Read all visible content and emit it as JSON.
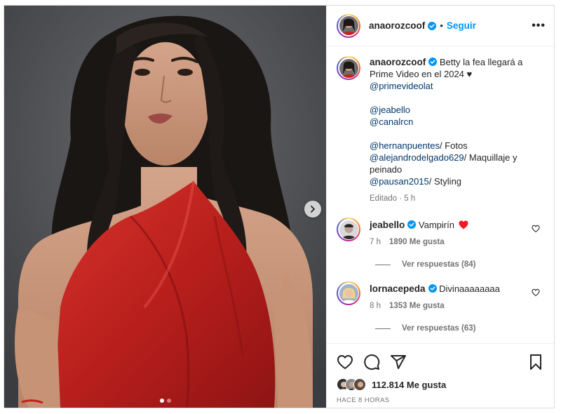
{
  "post": {
    "username": "anaorozcoof",
    "follow_label": "Seguir",
    "separator": "•",
    "more_label": "•••"
  },
  "caption": {
    "username": "anaorozcoof",
    "text": "Betty la fea llegará a Prime Video en el 2024 ♥",
    "mention_1": "@primevideolat",
    "mention_2": "@jeabello",
    "mention_3": "@canalrcn",
    "credit_1_user": "@hernanpuentes",
    "credit_1_text": "/ Fotos",
    "credit_2_user": "@alejandrodelgado629",
    "credit_2_text": "/ Maquillaje y peinado",
    "credit_3_user": "@pausan2015",
    "credit_3_text": "/ Styling",
    "meta": "Editado · 5 h"
  },
  "comments": [
    {
      "username": "jeabello",
      "text": "Vampirín",
      "time": "7 h",
      "likes": "1890 Me gusta",
      "replies": "Ver respuestas (84)"
    },
    {
      "username": "lornacepeda",
      "text": "Divinaaaaaaaa",
      "time": "8 h",
      "likes": "1353 Me gusta",
      "replies": "Ver respuestas (63)"
    }
  ],
  "footer": {
    "likes": "112.814 Me gusta",
    "time": "HACE 8 HORAS"
  },
  "carousel": {
    "slide_count": 2,
    "active_index": 0
  },
  "colors": {
    "accent_blue": "#0095f6",
    "link": "#00376b",
    "muted": "#737373",
    "heart_red": "#ed1c24"
  }
}
